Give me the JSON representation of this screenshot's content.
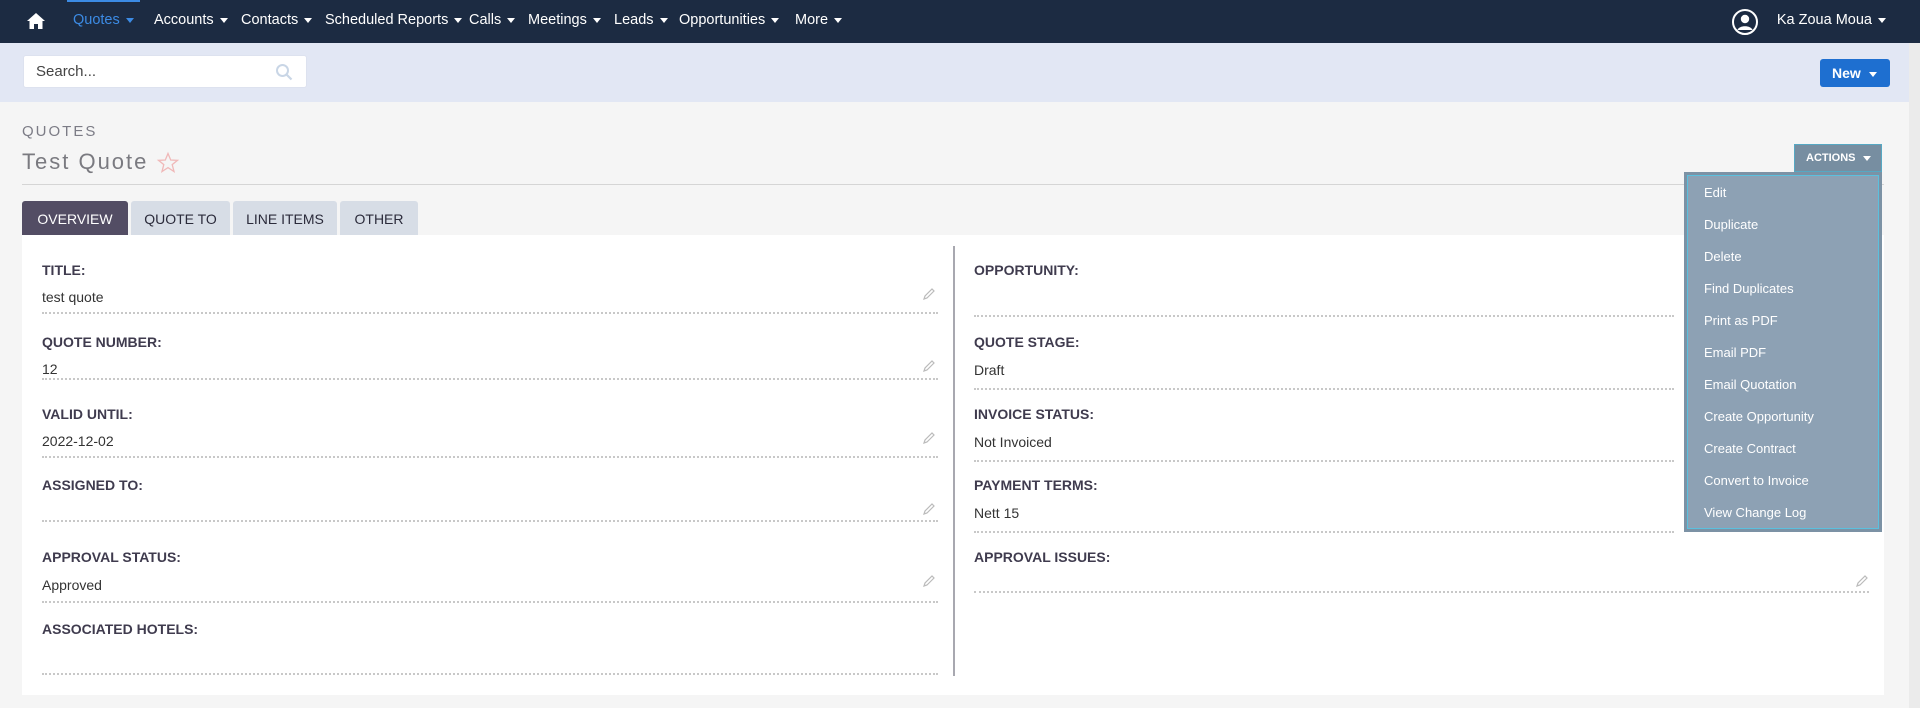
{
  "nav": {
    "items": [
      "Quotes",
      "Accounts",
      "Contacts",
      "Scheduled Reports",
      "Calls",
      "Meetings",
      "Leads",
      "Opportunities",
      "More"
    ],
    "active": "Quotes",
    "user": "Ka Zoua Moua"
  },
  "search": {
    "placeholder": "Search..."
  },
  "new_button": "New",
  "header": {
    "module": "QUOTES",
    "title": "Test Quote"
  },
  "actions": {
    "label": "ACTIONS",
    "menu": [
      "Edit",
      "Duplicate",
      "Delete",
      "Find Duplicates",
      "Print as PDF",
      "Email PDF",
      "Email Quotation",
      "Create Opportunity",
      "Create Contract",
      "Convert to Invoice",
      "View Change Log"
    ]
  },
  "tabs": [
    "OVERVIEW",
    "QUOTE TO",
    "LINE ITEMS",
    "OTHER"
  ],
  "fields": {
    "left": [
      {
        "label": "TITLE:",
        "value": "test quote"
      },
      {
        "label": "QUOTE NUMBER:",
        "value": "12"
      },
      {
        "label": "VALID UNTIL:",
        "value": "2022-12-02"
      },
      {
        "label": "ASSIGNED TO:",
        "value": ""
      },
      {
        "label": "APPROVAL STATUS:",
        "value": "Approved"
      },
      {
        "label": "ASSOCIATED HOTELS:",
        "value": ""
      }
    ],
    "right": [
      {
        "label": "OPPORTUNITY:",
        "value": ""
      },
      {
        "label": "QUOTE STAGE:",
        "value": "Draft"
      },
      {
        "label": "INVOICE STATUS:",
        "value": "Not Invoiced"
      },
      {
        "label": "PAYMENT TERMS:",
        "value": "Nett 15"
      },
      {
        "label": "APPROVAL ISSUES:",
        "value": ""
      }
    ]
  },
  "colors": {
    "nav_bg": "#1c2b42",
    "accent": "#3c8be4",
    "new_button": "#1e6fd0",
    "active_tab": "#534d64",
    "actions_menu": "#8da1b4"
  }
}
